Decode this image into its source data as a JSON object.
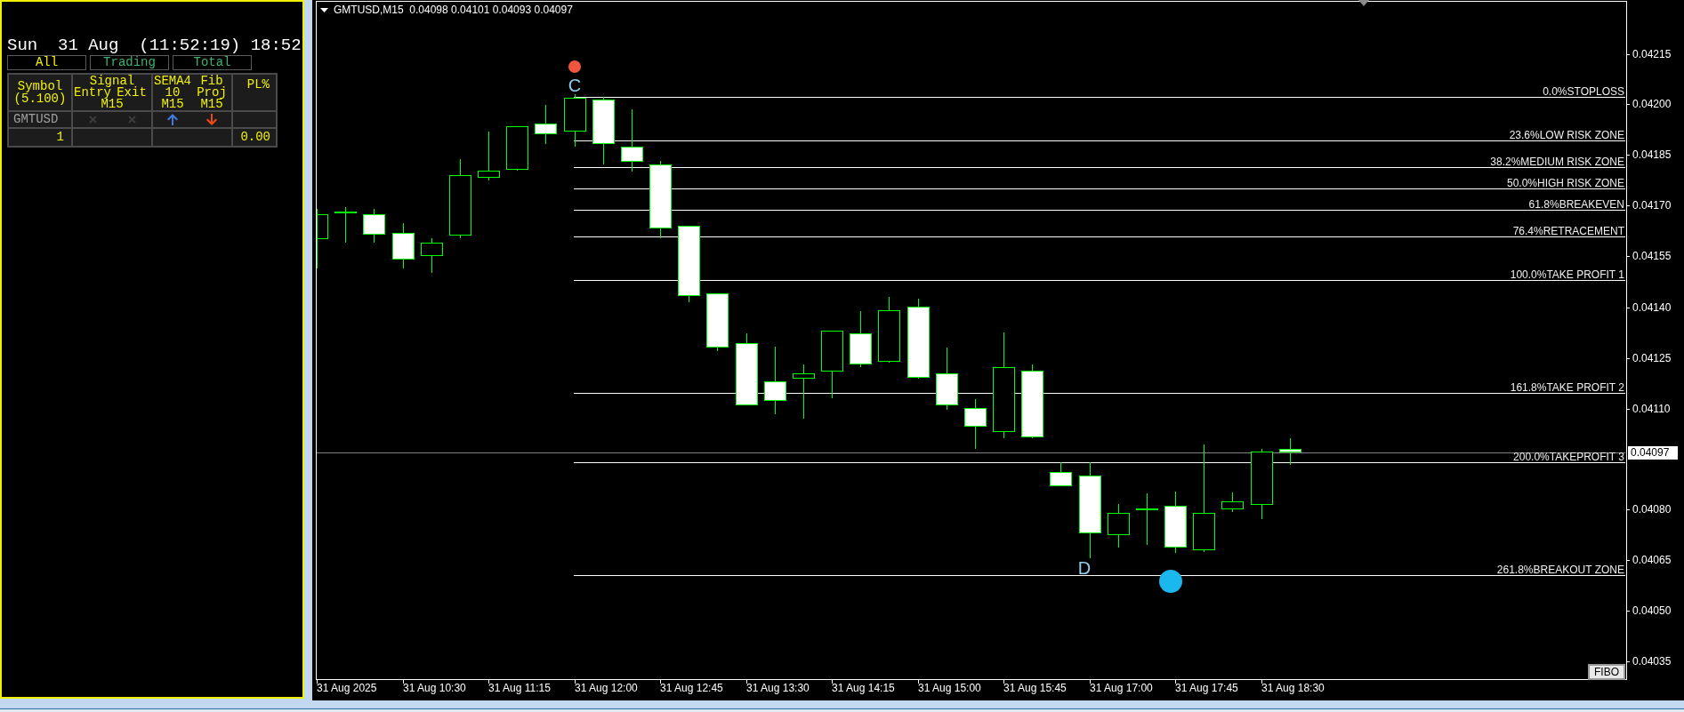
{
  "info_panel": {
    "clock": "Sun  31 Aug  (11:52:19) 18:52",
    "tabs": [
      {
        "label": "All",
        "selected": true
      },
      {
        "label": "Trading",
        "selected": false
      },
      {
        "label": "Total",
        "selected": false
      }
    ],
    "table": {
      "header": {
        "symbol": [
          "Symbol",
          "(5.100)"
        ],
        "signal": {
          "title": "Signal",
          "entry": "Entry",
          "exit": "Exit",
          "timeframe": "M15"
        },
        "indicators": [
          [
            "SEMA4",
            "10",
            "M15"
          ],
          [
            "Fib",
            "Proj",
            "M15"
          ]
        ],
        "pl": "PL%"
      },
      "rows": [
        {
          "symbol": "GMTUSD",
          "signals": [
            {
              "kind": "none"
            },
            {
              "kind": "none"
            },
            {
              "kind": "up"
            },
            {
              "kind": "down"
            }
          ]
        }
      ],
      "total": {
        "count": "1",
        "pl": "0.00"
      }
    }
  },
  "chart": {
    "title": "GMTUSD,M15  0.04098 0.04101 0.04093 0.04097",
    "fib_levels": [
      "0.0%STOPLOSS",
      "23.6%LOW RISK ZONE",
      "38.2%MEDIUM RISK ZONE",
      "50.0%HIGH RISK ZONE",
      "61.8%BREAKEVEN",
      "76.4%RETRACEMENT",
      "100.0%TAKE PROFIT 1",
      "161.8%TAKE PROFIT 2",
      "200.0%TAKEPROFIT 3",
      "261.8%BREAKOUT ZONE"
    ],
    "points": [
      {
        "label": "C",
        "color": "#f0553f"
      },
      {
        "label": "D",
        "color": "#1bb8ee"
      }
    ],
    "current_price": "0.04097",
    "price_axis": [
      "0.04215",
      "0.04200",
      "0.04185",
      "0.04170",
      "0.04155",
      "0.04140",
      "0.04125",
      "0.04110",
      "0.04080",
      "0.04065",
      "0.04050",
      "0.04035"
    ],
    "time_axis": [
      "31 Aug 2025",
      "31 Aug 10:30",
      "31 Aug 11:15",
      "31 Aug 12:00",
      "31 Aug 12:45",
      "31 Aug 13:30",
      "31 Aug 14:15",
      "31 Aug 15:00",
      "31 Aug 15:45",
      "31 Aug 17:00",
      "31 Aug 17:45",
      "31 Aug 18:30"
    ],
    "button": "FIBO"
  }
}
